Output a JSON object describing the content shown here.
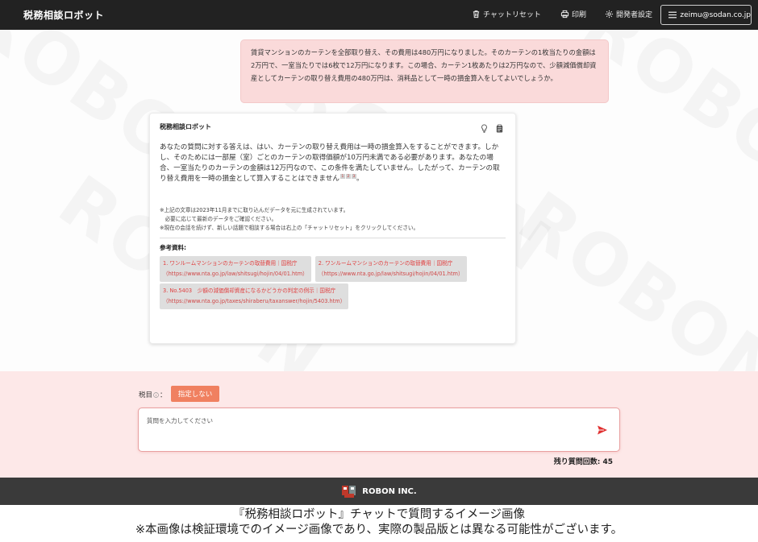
{
  "header": {
    "brand": "税務相談ロボット",
    "nav": [
      {
        "label": "チャットリセット",
        "icon": "trash-icon"
      },
      {
        "label": "印刷",
        "icon": "printer-icon"
      },
      {
        "label": "開発者設定",
        "icon": "gear-icon"
      }
    ],
    "user": {
      "label": "zeimu@sodan.co.jp",
      "icon": "hamburger-menu-icon"
    }
  },
  "watermark": "ROBON",
  "chat": {
    "user_message": "賃貸マンションのカーテンを全部取り替え、その費用は480万円になりました。そのカーテンの1枚当たりの金額は2万円で、一室当たりでは6枚で12万円になります。この場合、カーテン1枚あたりは2万円なので、少額減価償却資産としてカーテンの取り替え費用の480万円は、消耗品として一時の損金算入をしてよいでしょうか。",
    "bot": {
      "name": "税務相談ロボット",
      "answer": "あなたの質問に対する答えは、はい、カーテンの取り替え費用は一時の損金算入をすることができます。しかし、そのためには一部屋（室）ごとのカーテンの取得価額が10万円未満である必要があります。あなたの場合、一室当たりのカーテンの金額は12万円なので、この条件を満たしていません。したがって、カーテンの取り替え費用を一時の損金として算入することはできません",
      "citations": [
        "1",
        "2",
        "3"
      ],
      "answer_end": "。",
      "notes": [
        "※上記の文章は2023年11月までに取り込んだデータを元に生成されています。",
        "　必要に応じて最新のデータをご確認ください。",
        "※現在の会話を続けず、新しい話題で相談する場合は右上の「チャットリセット」をクリックしてください。"
      ],
      "refs_title": "参考資料:",
      "refs": [
        {
          "title": "1. ワンルームマンションのカーテンの取替費用｜国税庁",
          "url": "（https://www.nta.go.jp/law/shitsugi/hojin/04/01.htm）"
        },
        {
          "title": "2. ワンルームマンションのカーテンの取替費用｜国税庁",
          "url": "（https://www.nta.go.jp/law/shitsugi/hojin/04/01.htm）"
        },
        {
          "title": "3. No.5403　少額の減価償却資産になるかどうかの判定の例示｜国税庁",
          "url": "（https://www.nta.go.jp/taxes/shiraberu/taxanswer/hojin/5403.htm）"
        }
      ]
    }
  },
  "input": {
    "tax_label": "税目",
    "tax_colon": "：",
    "tax_button": "指定しない",
    "placeholder": "質問を入力してください",
    "remaining": "残り質問回数: 45"
  },
  "footer": {
    "company": "ROBON INC."
  },
  "caption": {
    "line1": "『税務相談ロボット』チャットで質問するイメージ画像",
    "line2": "※本画像は検証環境でのイメージ画像であり、実際の製品版とは異なる可能性がございます。"
  },
  "colors": {
    "header_bg": "#222222",
    "user_bubble": "#fadada",
    "accent": "#f08060",
    "input_panel": "#fde8e8",
    "footer_bg": "#3a3a3a"
  }
}
